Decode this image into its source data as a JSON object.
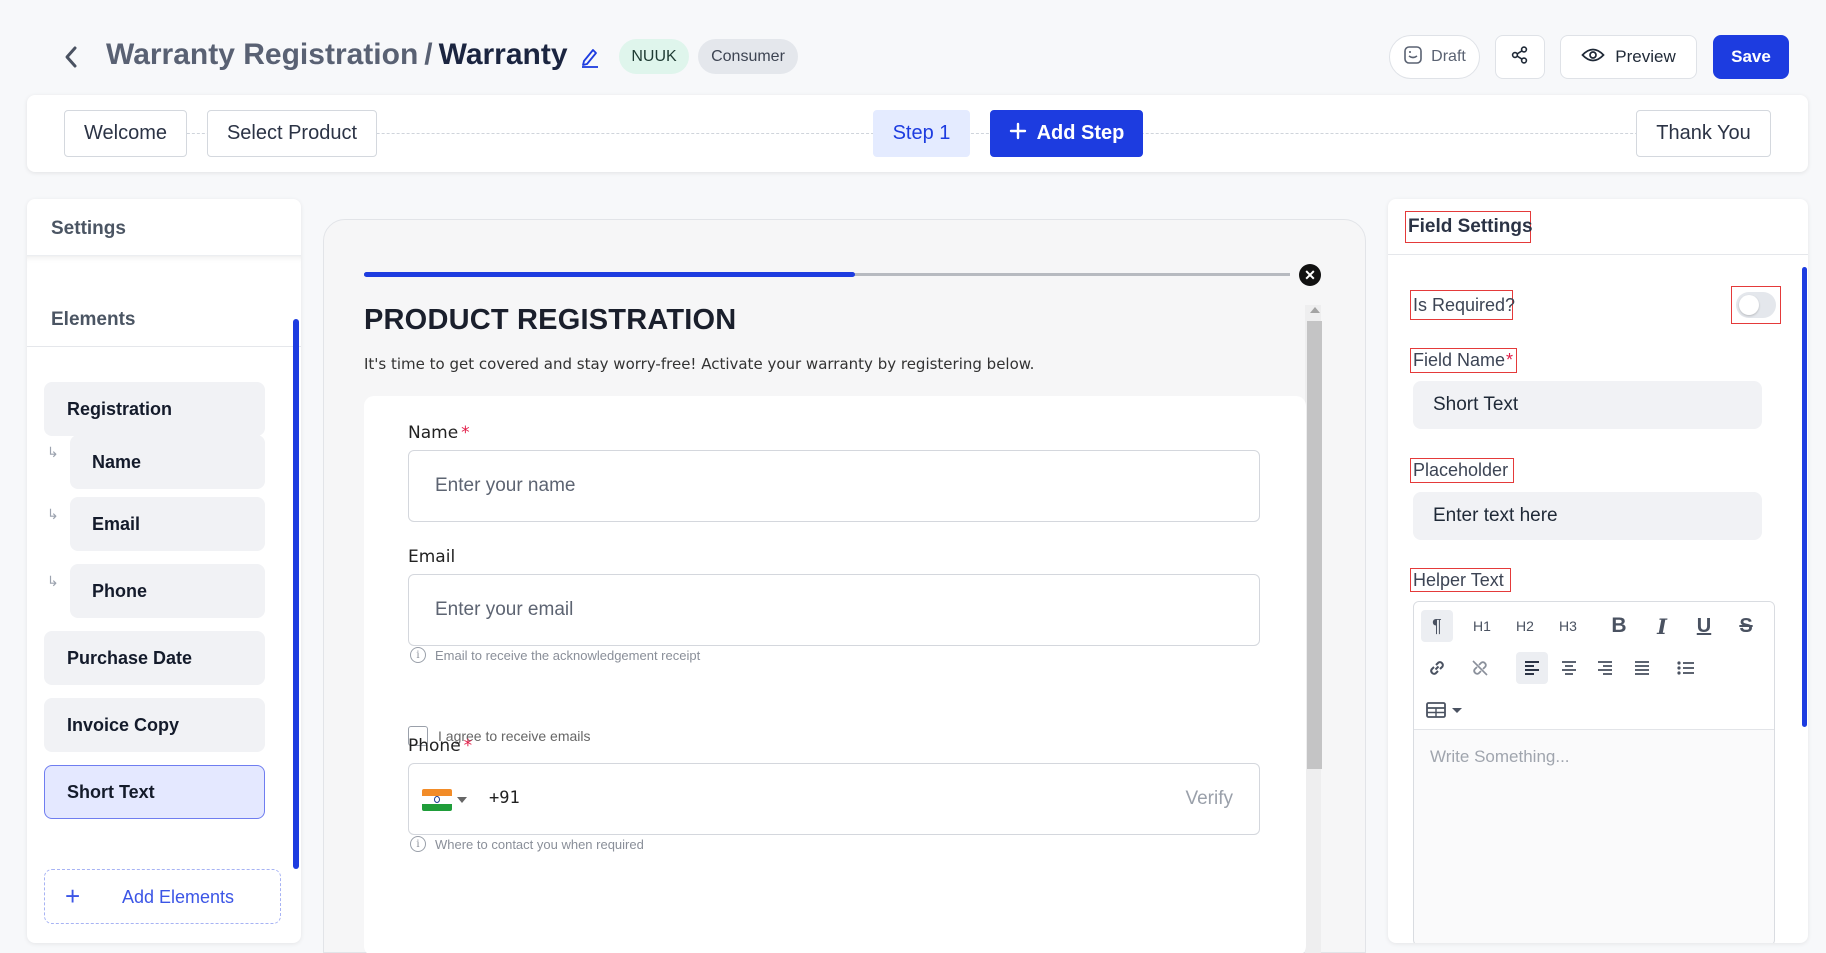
{
  "header": {
    "title_main": "Warranty Registration",
    "title_sep": "/",
    "title_sub": "Warranty",
    "badges": [
      "NUUK",
      "Consumer"
    ],
    "draft_label": "Draft",
    "preview_label": "Preview",
    "save_label": "Save"
  },
  "steps": {
    "welcome": "Welcome",
    "select_product": "Select Product",
    "step1": "Step 1",
    "add_step": "Add Step",
    "thank_you": "Thank You"
  },
  "left": {
    "settings_heading": "Settings",
    "elements_heading": "Elements",
    "items": [
      {
        "label": "Registration"
      },
      {
        "label": "Name"
      },
      {
        "label": "Email"
      },
      {
        "label": "Phone"
      },
      {
        "label": "Purchase Date"
      },
      {
        "label": "Invoice Copy"
      },
      {
        "label": "Short Text"
      }
    ],
    "active_item": "Short Text",
    "add_elements": "Add Elements"
  },
  "form": {
    "progress": 0.53,
    "title": "PRODUCT REGISTRATION",
    "description": "It's time to get covered and stay worry-free! Activate your warranty by registering below.",
    "name_label": "Name",
    "name_placeholder": "Enter your name",
    "email_label": "Email",
    "email_placeholder": "Enter your email",
    "email_help": "Email to receive the acknowledgement receipt",
    "agree_label": "I agree to receive emails",
    "phone_label": "Phone",
    "dial_code": "+91",
    "verify_label": "Verify",
    "phone_help": "Where to contact you when required",
    "required_mark": "*"
  },
  "field_settings": {
    "title": "Field Settings",
    "is_required_label": "Is Required?",
    "is_required": false,
    "field_name_label": "Field Name",
    "field_name_value": "Short Text",
    "placeholder_label": "Placeholder",
    "placeholder_value": "Enter text here",
    "helper_label": "Helper Text",
    "editor_placeholder": "Write Something...",
    "toolbar": {
      "h1": "H1",
      "h2": "H2",
      "h3": "H3",
      "bold": "B",
      "italic": "I",
      "underline": "U",
      "strike": "S",
      "paragraph": "¶"
    }
  },
  "colors": {
    "accent": "#1d3ce0",
    "annotation_red": "#e43a3a"
  }
}
